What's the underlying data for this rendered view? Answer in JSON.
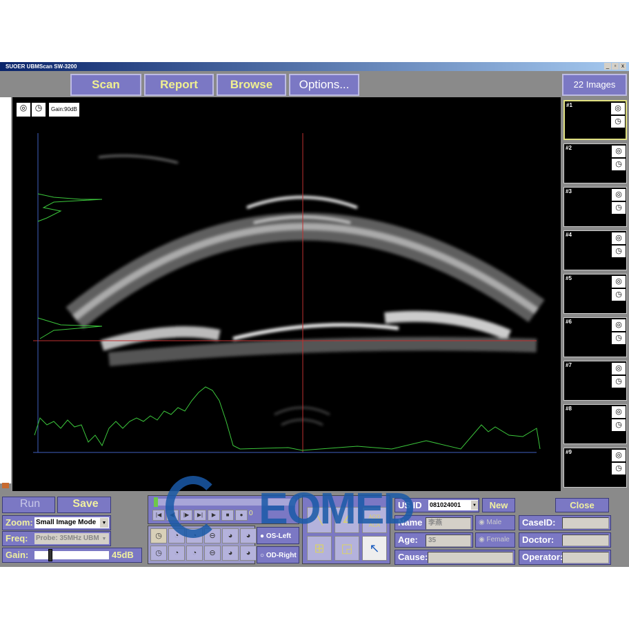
{
  "window": {
    "title": "SUOER UBMScan SW-3200",
    "min": "_",
    "max": "▫",
    "close": "x"
  },
  "toolbar": {
    "scan": "Scan",
    "report": "Report",
    "browse": "Browse",
    "options": "Options...",
    "image_count": "22 Images"
  },
  "image": {
    "gain_label": "Gain:90dB",
    "icons": [
      "eye-pair-icon",
      "clock-dial-icon"
    ]
  },
  "thumbnails": [
    "#1",
    "#2",
    "#3",
    "#4",
    "#5",
    "#6",
    "#7",
    "#8",
    "#9"
  ],
  "controls": {
    "run": "Run",
    "save": "Save",
    "zoom_label": "Zoom:",
    "zoom_value": "Small Image Mode",
    "freq_label": "Freq:",
    "freq_value": "Probe: 35MHz UBM",
    "gain_label": "Gain:",
    "gain_value": "45dB",
    "gain_fraction": 0.2,
    "frame_counter": "0",
    "os_left": "OS-Left",
    "od_right": "OD-Right",
    "measure_text": "AOD ACA"
  },
  "patient": {
    "usid_label": "US ID",
    "usid_value": "081024001",
    "new": "New",
    "close": "Close",
    "name_label": "Name",
    "name_value": "李燕",
    "male": "Male",
    "female": "Female",
    "age_label": "Age:",
    "age_value": "35",
    "cause_label": "Cause:",
    "caseid_label": "CaseID:",
    "doctor_label": "Doctor:",
    "operator_label": "Operator:"
  },
  "watermark": "EOMED",
  "colors": {
    "button": "#7b78c4",
    "button_text": "#f0f090",
    "waveform": "#3cc83c",
    "crosshair": "#c03030"
  }
}
